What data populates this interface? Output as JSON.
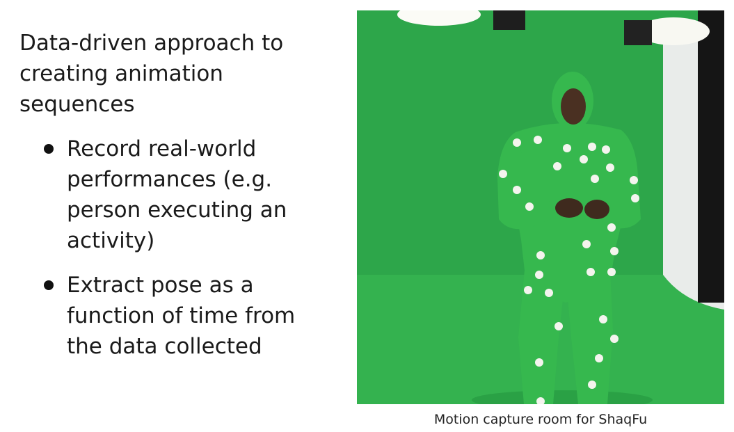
{
  "intro": "Data-driven approach to creating animation sequences",
  "bullets": [
    "Record real-world performances (e.g. person executing an activity)",
    "Extract pose as a function of time from the data collected"
  ],
  "figure": {
    "caption": "Motion capture room for ShaqFu",
    "background_color": "#2fa84a",
    "suit_color": "#35b64d",
    "marker_color": "#f4f4ee"
  }
}
